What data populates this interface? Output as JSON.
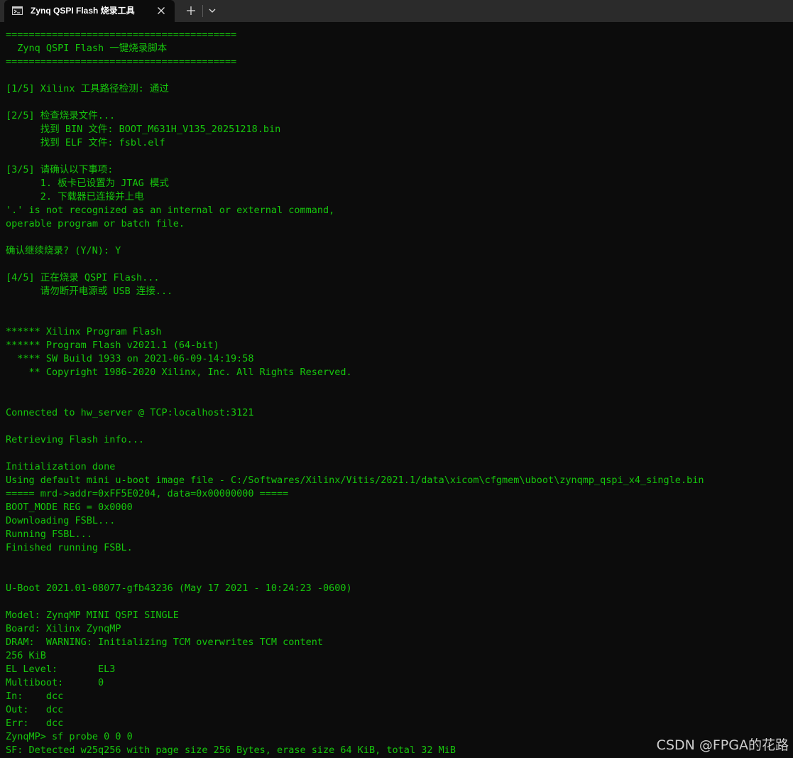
{
  "tab": {
    "title": "Zynq QSPI Flash 烧录工具",
    "icon": "terminal-icon",
    "close_icon": "close-icon"
  },
  "tabbar": {
    "new_tab_icon": "plus-icon",
    "dropdown_icon": "chevron-down-icon"
  },
  "colors": {
    "terminal_background": "#0c0c0c",
    "terminal_text": "#16c60c",
    "tabbar_background": "#2b2b2b"
  },
  "terminal": {
    "lines": [
      "========================================",
      "  Zynq QSPI Flash 一键烧录脚本",
      "========================================",
      "",
      "[1/5] Xilinx 工具路径检测: 通过",
      "",
      "[2/5] 检查烧录文件...",
      "      找到 BIN 文件: BOOT_M631H_V135_20251218.bin",
      "      找到 ELF 文件: fsbl.elf",
      "",
      "[3/5] 请确认以下事项:",
      "      1. 板卡已设置为 JTAG 模式",
      "      2. 下载器已连接并上电",
      "'.' is not recognized as an internal or external command,",
      "operable program or batch file.",
      "",
      "确认继续烧录? (Y/N): Y",
      "",
      "[4/5] 正在烧录 QSPI Flash...",
      "      请勿断开电源或 USB 连接...",
      "",
      "",
      "****** Xilinx Program Flash",
      "****** Program Flash v2021.1 (64-bit)",
      "  **** SW Build 1933 on 2021-06-09-14:19:58",
      "    ** Copyright 1986-2020 Xilinx, Inc. All Rights Reserved.",
      "",
      "",
      "Connected to hw_server @ TCP:localhost:3121",
      "",
      "Retrieving Flash info...",
      "",
      "Initialization done",
      "Using default mini u-boot image file - C:/Softwares/Xilinx/Vitis/2021.1/data\\xicom\\cfgmem\\uboot\\zynqmp_qspi_x4_single.bin",
      "===== mrd->addr=0xFF5E0204, data=0x00000000 =====",
      "BOOT_MODE REG = 0x0000",
      "Downloading FSBL...",
      "Running FSBL...",
      "Finished running FSBL.",
      "",
      "",
      "U-Boot 2021.01-08077-gfb43236 (May 17 2021 - 10:24:23 -0600)",
      "",
      "Model: ZynqMP MINI QSPI SINGLE",
      "Board: Xilinx ZynqMP",
      "DRAM:  WARNING: Initializing TCM overwrites TCM content",
      "256 KiB",
      "EL Level:       EL3",
      "Multiboot:      0",
      "In:    dcc",
      "Out:   dcc",
      "Err:   dcc",
      "ZynqMP> sf probe 0 0 0",
      "SF: Detected w25q256 with page size 256 Bytes, erase size 64 KiB, total 32 MiB"
    ]
  },
  "watermark": "CSDN @FPGA的花路"
}
